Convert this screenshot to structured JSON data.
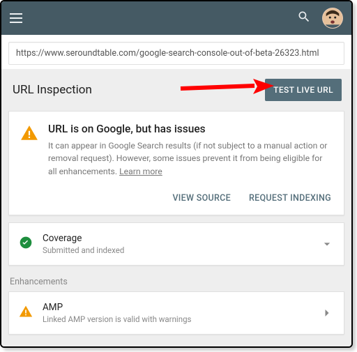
{
  "topbar": {},
  "urlbar": {
    "value": "https://www.seroundtable.com/google-search-console-out-of-beta-26323.html"
  },
  "inspection": {
    "title": "URL Inspection",
    "test_btn": "TEST LIVE URL"
  },
  "status": {
    "title": "URL is on Google, but has issues",
    "desc": "It can appear in Google Search results (if not subject to a manual action or removal request). However, some issues prevent it from being eligible for all enhancements. ",
    "learn": "Learn more",
    "view_source": "VIEW SOURCE",
    "request_index": "REQUEST INDEXING"
  },
  "coverage": {
    "title": "Coverage",
    "sub": "Submitted and indexed"
  },
  "enh_label": "Enhancements",
  "amp": {
    "title": "AMP",
    "sub": "Linked AMP version is valid with warnings"
  }
}
